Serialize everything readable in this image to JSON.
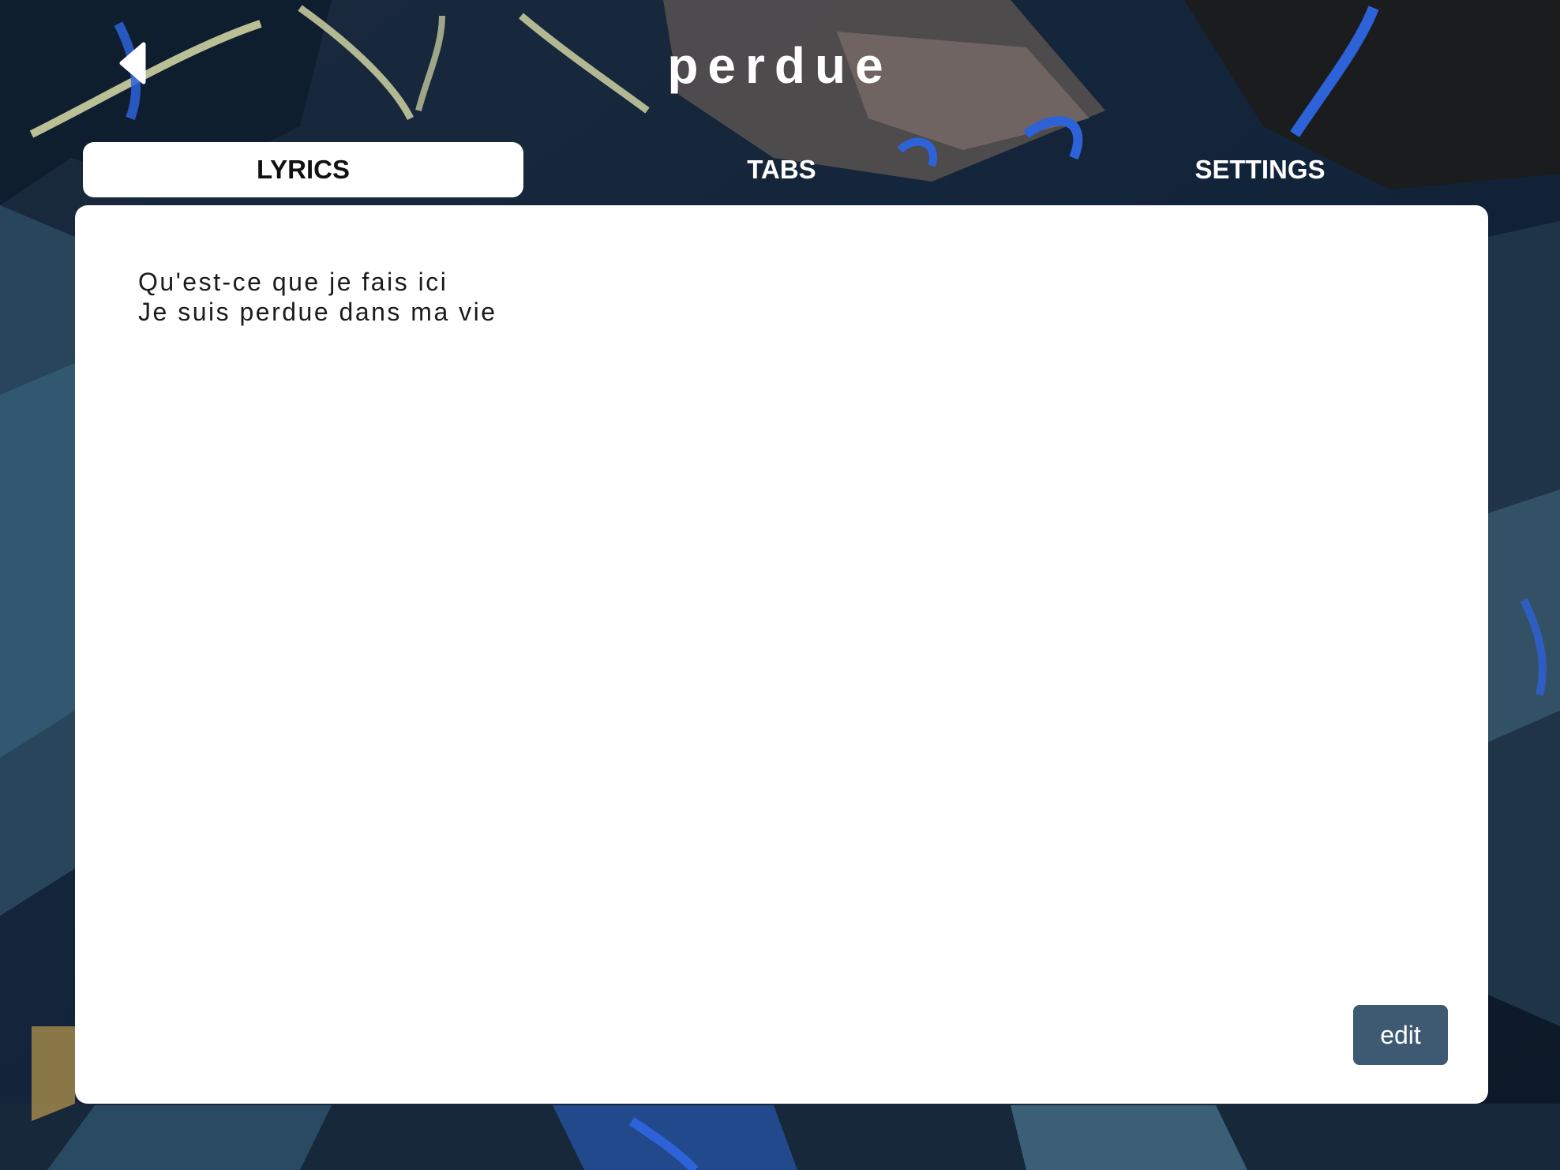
{
  "header": {
    "title": "perdue",
    "back_icon": "chevron-left-icon"
  },
  "tabs": [
    {
      "label": "LYRICS",
      "active": true
    },
    {
      "label": "TABS",
      "active": false
    },
    {
      "label": "SETTINGS",
      "active": false
    }
  ],
  "lyrics": {
    "lines": [
      "Qu'est-ce que je fais ici",
      "Je suis perdue dans ma vie"
    ]
  },
  "actions": {
    "edit_label": "edit"
  },
  "colors": {
    "panel": "#ffffff",
    "edit_button": "#3e5a72",
    "text": "#1b1b1b",
    "background": "#0d1a2b"
  }
}
